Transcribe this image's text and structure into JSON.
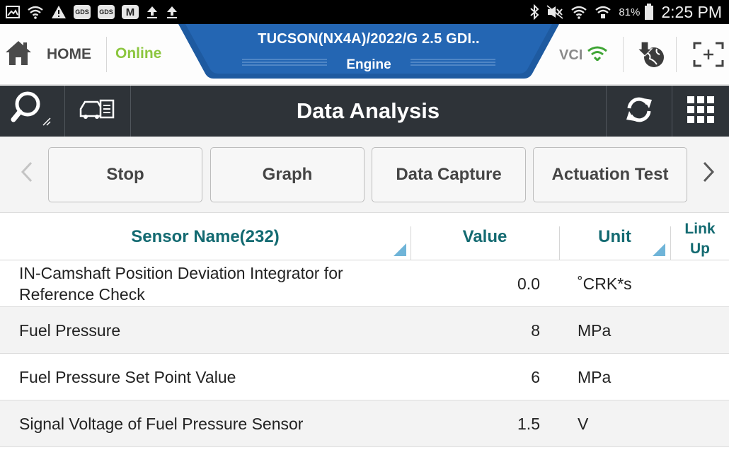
{
  "status_bar": {
    "left_icons": [
      "gallery-icon",
      "wifi-icon",
      "warning-icon",
      "gds-icon",
      "gds-icon",
      "gds-m-icon",
      "upload-icon",
      "upload-icon"
    ],
    "gds_badge": "GDS",
    "m_badge": "M",
    "right_icons": [
      "bluetooth-icon",
      "mute-icon",
      "wifi-icon",
      "wifi-calling-icon",
      "battery-icon"
    ],
    "battery_percent": "81%",
    "time": "2:25 PM"
  },
  "header": {
    "home_label": "HOME",
    "connection_status": "Online",
    "vehicle_name": "TUCSON(NX4A)/2022/G 2.5 GDI..",
    "vehicle_system": "Engine",
    "vci_label": "VCI",
    "colors": {
      "tab_blue": "#1e5aa0",
      "online_green": "#8cc63f",
      "vci_green": "#3fa535"
    }
  },
  "toolbar": {
    "title": "Data Analysis",
    "left_icons": [
      "search-icon",
      "vehicle-document-icon"
    ],
    "right_icons": [
      "refresh-icon",
      "grid-menu-icon"
    ]
  },
  "function_buttons": {
    "labels": [
      "Stop",
      "Graph",
      "Data Capture",
      "Actuation Test"
    ],
    "prev_icon": "chevron-left-icon",
    "next_icon": "chevron-right-icon"
  },
  "table": {
    "headers": {
      "sensor_name": "Sensor Name(232)",
      "value": "Value",
      "unit": "Unit",
      "link_up_line1": "Link",
      "link_up_line2": "Up"
    },
    "rows": [
      {
        "name": "IN-Camshaft Position Deviation Integrator for Reference Check",
        "value": "0.0",
        "unit": "˚CRK*s"
      },
      {
        "name": "Fuel Pressure",
        "value": "8",
        "unit": "MPa"
      },
      {
        "name": "Fuel Pressure Set Point Value",
        "value": "6",
        "unit": "MPa"
      },
      {
        "name": "Signal Voltage of Fuel Pressure Sensor",
        "value": "1.5",
        "unit": "V"
      }
    ]
  }
}
